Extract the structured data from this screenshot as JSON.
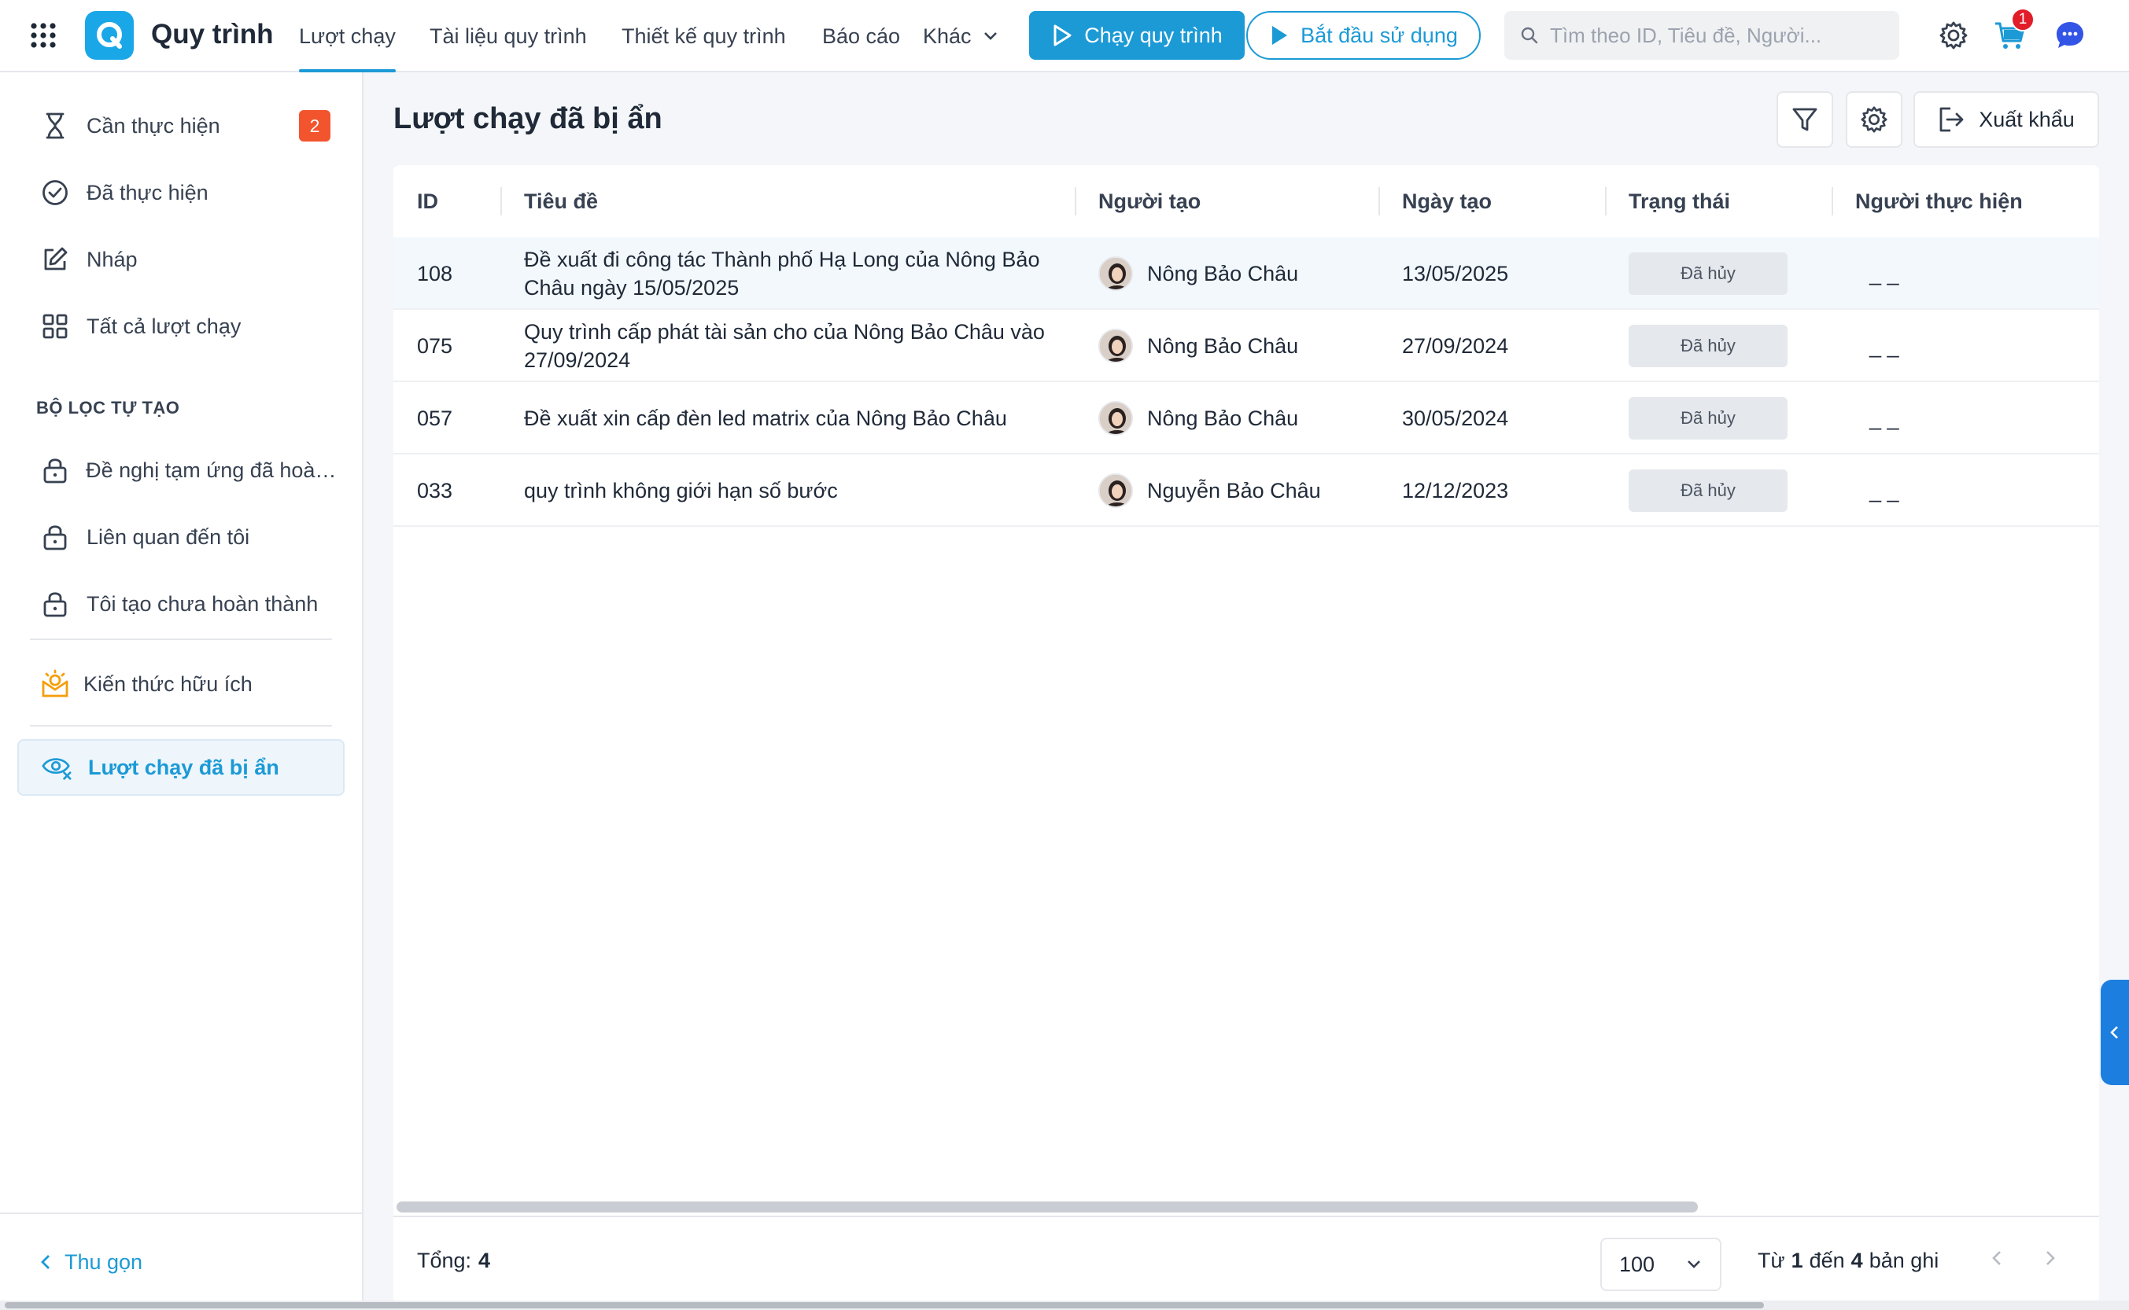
{
  "header": {
    "app_title": "Quy trình",
    "nav": [
      {
        "label": "Lượt chạy"
      },
      {
        "label": "Tài liệu quy trình"
      },
      {
        "label": "Thiết kế quy trình"
      },
      {
        "label": "Báo cáo"
      },
      {
        "label": "Khác"
      }
    ],
    "run_button": "Chạy quy trình",
    "start_button": "Bắt đầu sử dụng",
    "search_placeholder": "Tìm theo ID, Tiêu đề, Người...",
    "cart_badge": "1"
  },
  "sidebar": {
    "items": [
      {
        "label": "Cần thực hiện",
        "badge": "2",
        "icon": "hourglass-icon"
      },
      {
        "label": "Đã thực hiện",
        "icon": "check-circle-icon"
      },
      {
        "label": "Nháp",
        "icon": "edit-icon"
      },
      {
        "label": "Tất cả lượt chạy",
        "icon": "grid-icon"
      }
    ],
    "section_title": "BỘ LỌC TỰ TẠO",
    "filters": [
      {
        "label": "Đề nghị tạm ứng đã hoàn ...",
        "icon": "lock-icon"
      },
      {
        "label": "Liên quan đến tôi",
        "icon": "lock-icon"
      },
      {
        "label": "Tôi tạo chưa hoàn thành",
        "icon": "lock-icon"
      }
    ],
    "knowledge": "Kiến thức hữu ích",
    "hidden_runs": "Lượt chạy đã bị ẩn",
    "collapse": "Thu gọn"
  },
  "main": {
    "title": "Lượt chạy đã bị ẩn",
    "export": "Xuất khẩu",
    "columns": [
      "ID",
      "Tiêu đề",
      "Người tạo",
      "Ngày tạo",
      "Trạng thái",
      "Người thực hiện"
    ],
    "rows": [
      {
        "id": "108",
        "title_line1": "Đề xuất đi công tác Thành phố Hạ Long của Nông Bảo",
        "title_line2": "Châu ngày 15/05/2025",
        "creator": "Nông Bảo Châu",
        "date": "13/05/2025",
        "status": "Đã hủy",
        "assignee": "_ _"
      },
      {
        "id": "075",
        "title_line1": "Quy trình cấp phát tài sản cho của Nông Bảo Châu vào",
        "title_line2": "27/09/2024",
        "creator": "Nông Bảo Châu",
        "date": "27/09/2024",
        "status": "Đã hủy",
        "assignee": "_ _"
      },
      {
        "id": "057",
        "title_line1": "Đề xuất xin cấp đèn led matrix của Nông Bảo Châu",
        "title_line2": "",
        "creator": "Nông Bảo Châu",
        "date": "30/05/2024",
        "status": "Đã hủy",
        "assignee": "_ _"
      },
      {
        "id": "033",
        "title_line1": "quy trình không giới hạn số bước",
        "title_line2": "",
        "creator": "Nguyễn Bảo Châu",
        "date": "12/12/2023",
        "status": "Đã hủy",
        "assignee": "_ _"
      }
    ],
    "footer": {
      "total_label": "Tổng:",
      "total_value": "4",
      "page_size": "100",
      "range_from_label": "Từ",
      "range_from": "1",
      "range_to_label": "đến",
      "range_to": "4",
      "range_suffix": "bản ghi"
    }
  }
}
